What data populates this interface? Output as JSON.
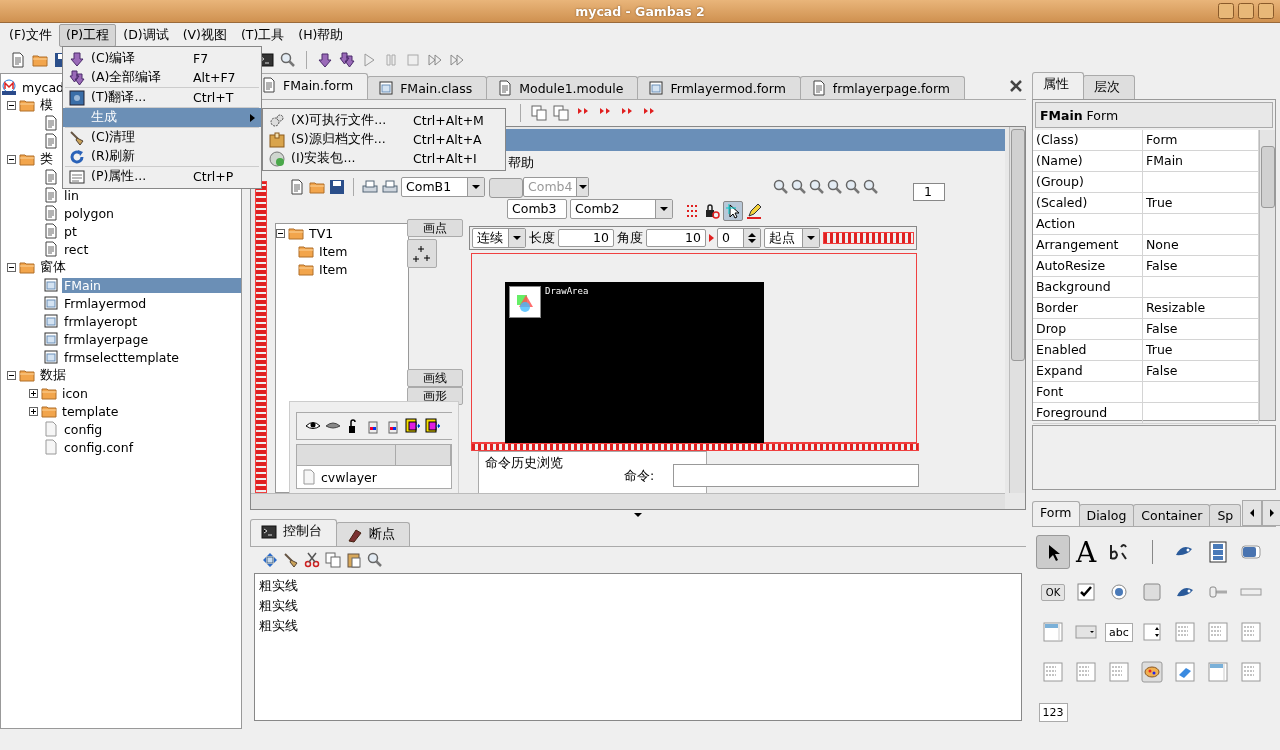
{
  "window": {
    "title": "mycad - Gambas 2"
  },
  "menubar": [
    {
      "label": "(F)文件",
      "selected": false
    },
    {
      "label": "(P)工程",
      "selected": true
    },
    {
      "label": "(D)调试",
      "selected": false
    },
    {
      "label": "(V)视图",
      "selected": false
    },
    {
      "label": "(T)工具",
      "selected": false
    },
    {
      "label": "(H)帮助",
      "selected": false
    }
  ],
  "project_menu": [
    {
      "kind": "item",
      "label": "(C)编译",
      "shortcut": "F7",
      "selected": false
    },
    {
      "kind": "item",
      "label": "(A)全部编译",
      "shortcut": "Alt+F7",
      "selected": false
    },
    {
      "kind": "item",
      "label": "(T)翻译...",
      "shortcut": "Ctrl+T",
      "selected": false
    },
    {
      "kind": "submenu",
      "label": "生成",
      "selected": true
    },
    {
      "kind": "item",
      "label": "(C)清理",
      "selected": false
    },
    {
      "kind": "item",
      "label": "(R)刷新",
      "selected": false
    },
    {
      "kind": "item",
      "label": "(P)属性...",
      "shortcut": "Ctrl+P",
      "selected": false
    }
  ],
  "build_submenu": [
    {
      "label": "(X)可执行文件...",
      "shortcut": "Ctrl+Alt+M"
    },
    {
      "label": "(S)源归档文件...",
      "shortcut": "Ctrl+Alt+A"
    },
    {
      "label": "(I)安装包...",
      "shortcut": "Ctrl+Alt+I"
    }
  ],
  "project_tree": [
    {
      "kind": "project",
      "label": "mycad",
      "selected": false,
      "children": [
        {
          "kind": "folder",
          "label": "模",
          "expanded": true,
          "selected": false,
          "children": [
            {
              "kind": "module"
            },
            {
              "kind": "class"
            }
          ]
        },
        {
          "kind": "folder",
          "label": "类",
          "expanded": true,
          "selected": false,
          "children": [
            {
              "kind": "class"
            },
            {
              "kind": "class",
              "label": "lin",
              "selected": false
            },
            {
              "kind": "class",
              "label": "polygon",
              "selected": false
            },
            {
              "kind": "class",
              "label": "pt",
              "selected": false
            },
            {
              "kind": "class",
              "label": "rect",
              "selected": false
            }
          ]
        },
        {
          "kind": "folder",
          "label": "窗体",
          "expanded": true,
          "selected": false,
          "children": [
            {
              "kind": "form",
              "label": "FMain",
              "selected": true
            },
            {
              "kind": "form",
              "label": "Frmlayermod",
              "selected": false
            },
            {
              "kind": "form",
              "label": "frmlayeropt",
              "selected": false
            },
            {
              "kind": "form",
              "label": "frmlayerpage",
              "selected": false
            },
            {
              "kind": "form",
              "label": "frmselecttemplate",
              "selected": false
            }
          ]
        },
        {
          "kind": "folder",
          "label": "数据",
          "expanded": true,
          "selected": false,
          "children": [
            {
              "kind": "folder",
              "label": "icon",
              "expanded": false,
              "selected": false
            },
            {
              "kind": "folder",
              "label": "template",
              "expanded": false,
              "selected": false
            },
            {
              "kind": "file",
              "label": "config",
              "selected": false
            },
            {
              "kind": "file",
              "label": "config.conf",
              "selected": false
            }
          ]
        }
      ]
    }
  ],
  "editor_tabs": [
    {
      "label": "FMain.form",
      "selected": true
    },
    {
      "label": "FMain.class",
      "selected": false
    },
    {
      "label": "Module1.module",
      "selected": false
    },
    {
      "label": "Frmlayermod.form",
      "selected": false
    },
    {
      "label": "frmlayerpage.form",
      "selected": false
    }
  ],
  "form_designer": {
    "menu_item": "帮助",
    "combos": [
      {
        "kind": "combo",
        "value": "ComB1",
        "disabled": false
      },
      {
        "kind": "combo",
        "value": "Comb4",
        "disabled": true
      },
      {
        "kind": "field",
        "value": "Comb3",
        "disabled": false
      },
      {
        "kind": "combo",
        "value": "Comb2",
        "disabled": false
      }
    ],
    "page_field": "1",
    "mode_combo": "连续",
    "length_label": "长度",
    "length_value": "10",
    "angle_label": "角度",
    "angle_value": "10",
    "spin_value": "0",
    "start_combo": "起点",
    "tree": {
      "label": "TV1",
      "items": [
        "Item",
        "Item"
      ]
    },
    "buttons": [
      "画点",
      "画线",
      "画形"
    ],
    "layers": [
      "cvwlayer"
    ],
    "draw_area_label": "DrawArea",
    "history_label": "命令历史浏览",
    "command_label": "命令:"
  },
  "properties_panel": {
    "tabs": [
      {
        "label": "属性",
        "selected": true
      },
      {
        "label": "层次",
        "selected": false
      }
    ],
    "header": "**FMain** Form",
    "rows": [
      {
        "name": "(Class)",
        "value": "Form"
      },
      {
        "name": "(Name)",
        "value": "FMain"
      },
      {
        "name": "(Group)",
        "value": ""
      },
      {
        "name": "(Scaled)",
        "value": "True"
      },
      {
        "name": "Action",
        "value": ""
      },
      {
        "name": "Arrangement",
        "value": "None"
      },
      {
        "name": "AutoResize",
        "value": "False"
      },
      {
        "name": "Background",
        "value": ""
      },
      {
        "name": "Border",
        "value": "Resizable"
      },
      {
        "name": "Drop",
        "value": "False"
      },
      {
        "name": "Enabled",
        "value": "True"
      },
      {
        "name": "Expand",
        "value": "False"
      },
      {
        "name": "Font",
        "value": ""
      },
      {
        "name": "Foreground",
        "value": ""
      }
    ]
  },
  "toolbox": {
    "tabs": [
      {
        "label": "Form",
        "selected": true
      },
      {
        "label": "Dialog",
        "selected": false
      },
      {
        "label": "Container",
        "selected": false
      },
      {
        "label": "Sp",
        "selected": false
      }
    ],
    "label_glyph": "A",
    "ok_label": "OK",
    "text_label": "abc",
    "number_label": "123"
  },
  "console": {
    "tabs": [
      {
        "label": "控制台",
        "selected": true
      },
      {
        "label": "断点",
        "selected": false
      }
    ],
    "lines": [
      "粗实线",
      "粗实线",
      "粗实线"
    ]
  }
}
